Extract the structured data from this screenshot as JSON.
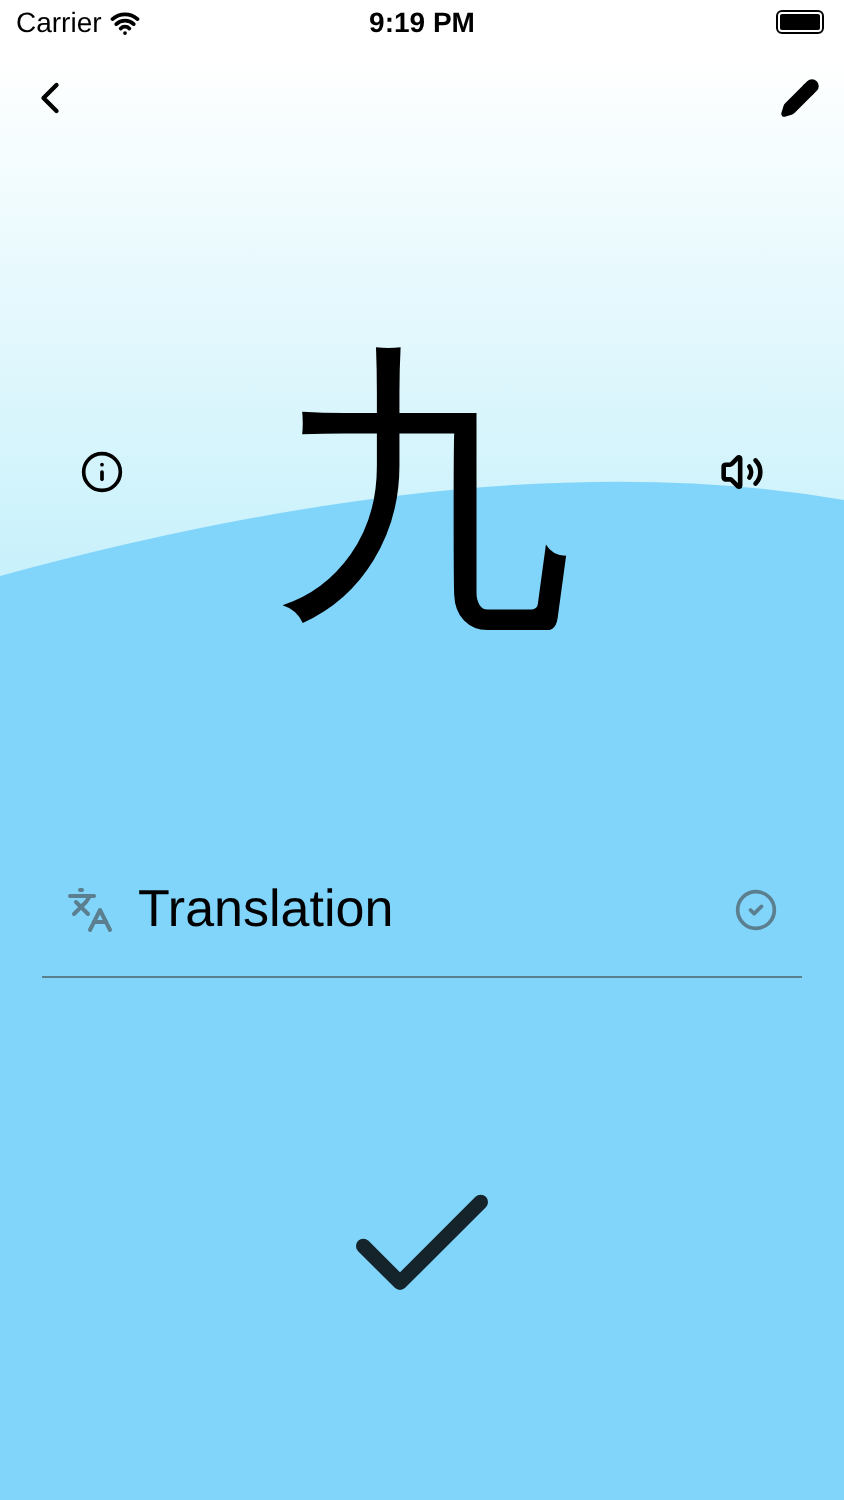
{
  "status_bar": {
    "carrier": "Carrier",
    "time": "9:19 PM"
  },
  "card": {
    "character": "九"
  },
  "translation_field": {
    "placeholder": "Translation"
  }
}
